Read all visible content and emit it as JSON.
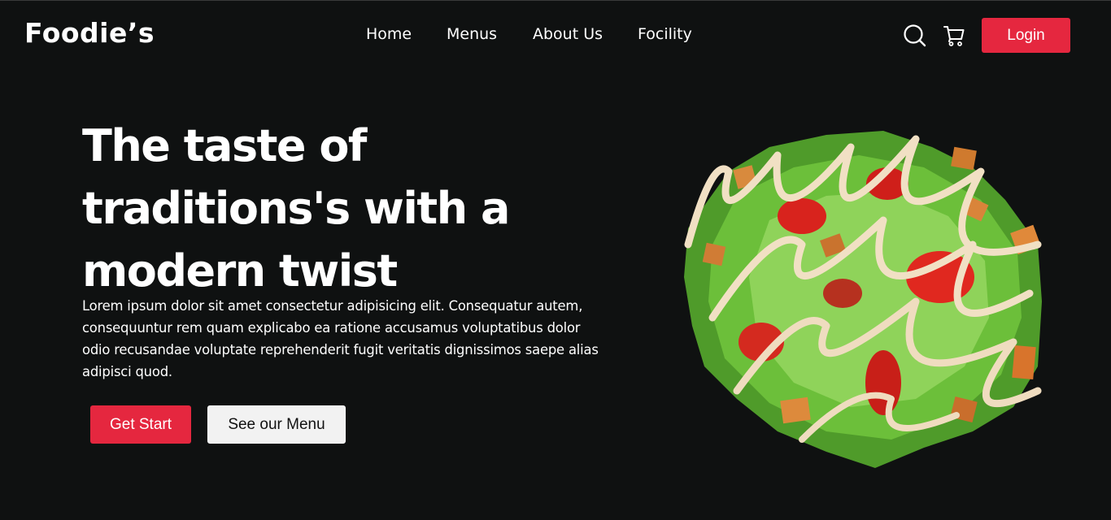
{
  "brand": {
    "name": "Foodie’s"
  },
  "nav": {
    "items": [
      {
        "label": "Home"
      },
      {
        "label": "Menus"
      },
      {
        "label": "About Us"
      },
      {
        "label": "Focility"
      }
    ],
    "login_label": "Login",
    "icons": [
      "search-icon",
      "cart-icon"
    ]
  },
  "hero": {
    "title_lines": [
      "The taste of",
      "traditions's with a",
      "modern twist"
    ],
    "description": "Lorem ipsum dolor sit amet consectetur adipisicing elit. Consequatur autem, consequuntur rem quam explicabo ea ratione accusamus voluptatibus dolor odio recusandae voluptate reprehenderit fugit veritatis dignissimos saepe alias adipisci quod.",
    "primary_button": "Get Start",
    "secondary_button": "See our Menu",
    "image": "salad-image"
  },
  "colors": {
    "background": "#0f1111",
    "accent": "#e5273f",
    "text": "#ffffff"
  }
}
